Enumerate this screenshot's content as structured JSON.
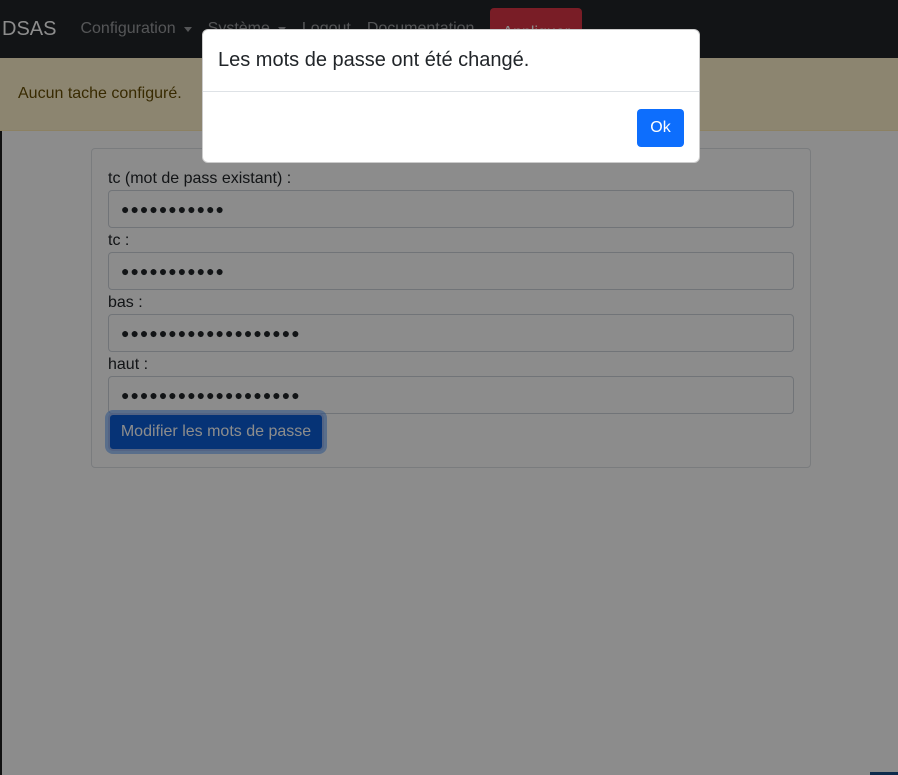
{
  "navbar": {
    "brand": "DSAS",
    "items": [
      {
        "label": "Configuration",
        "dropdown": true
      },
      {
        "label": "Système",
        "dropdown": true
      },
      {
        "label": "Logout",
        "dropdown": false
      },
      {
        "label": "Documentation",
        "dropdown": false
      }
    ],
    "apply_label": "Appliquer"
  },
  "alert": {
    "message": "Aucun tache configuré."
  },
  "form": {
    "fields": [
      {
        "label": "tc (mot de pass existant) :",
        "value": "●●●●●●●●●●●"
      },
      {
        "label": "tc :",
        "value": "●●●●●●●●●●●"
      },
      {
        "label": "bas :",
        "value": "●●●●●●●●●●●●●●●●●●●"
      },
      {
        "label": "haut :",
        "value": "●●●●●●●●●●●●●●●●●●●"
      }
    ],
    "submit_label": "Modifier les mots de passe"
  },
  "modal": {
    "message": "Les mots de passe ont été changé.",
    "ok_label": "Ok"
  },
  "colors": {
    "navbar_bg": "#212529",
    "alert_bg": "#fff3cd",
    "primary": "#0d6efd",
    "danger": "#dc3545"
  }
}
